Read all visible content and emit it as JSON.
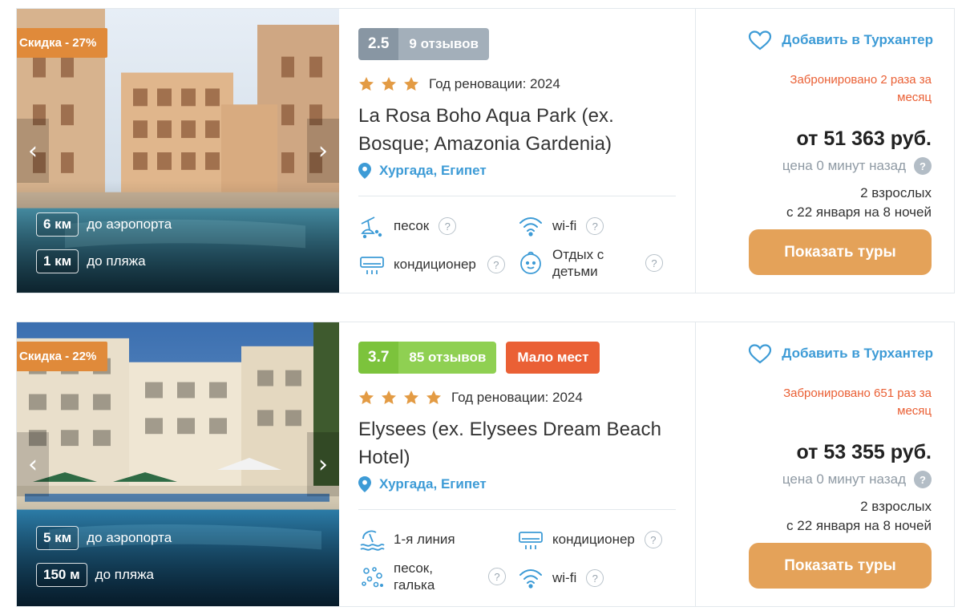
{
  "hotels": [
    {
      "discount": "Скидка - 27%",
      "airport_distance": "6 км",
      "airport_label": "до аэропорта",
      "beach_distance": "1 км",
      "beach_label": "до пляжа",
      "rating": "2.5",
      "reviews": "9 отзывов",
      "stars": 3,
      "renovation": "Год реновации: 2024",
      "name": "La Rosa Boho Aqua Park (ex. Bosque; Amazonia Gardenia)",
      "location": "Хургада, Египет",
      "amenities": [
        {
          "label": "песок",
          "icon": "sand-beach-icon"
        },
        {
          "label": "wi-fi",
          "icon": "wifi-icon"
        },
        {
          "label": "кондиционер",
          "icon": "air-conditioner-icon"
        },
        {
          "label": "Отдых с детьми",
          "icon": "kids-icon"
        }
      ],
      "favorite_label": "Добавить в Турхантер",
      "booked": "Забронировано 2 раза за месяц",
      "price": "от 51 363 руб.",
      "price_age": "цена 0 минут назад",
      "guests": "2 взрослых",
      "dates": "с 22 января на 8 ночей",
      "button": "Показать туры"
    },
    {
      "discount": "Скидка - 22%",
      "airport_distance": "5 км",
      "airport_label": "до аэропорта",
      "beach_distance": "150 м",
      "beach_label": "до пляжа",
      "rating": "3.7",
      "reviews": "85 отзывов",
      "few_places": "Мало мест",
      "stars": 4,
      "renovation": "Год реновации: 2024",
      "name": "Elysees (ex. Elysees Dream Beach Hotel)",
      "location": "Хургада, Египет",
      "amenities": [
        {
          "label": "1-я линия",
          "icon": "first-line-beach-icon"
        },
        {
          "label": "кондиционер",
          "icon": "air-conditioner-icon"
        },
        {
          "label": "песок, галька",
          "icon": "sand-pebble-icon"
        },
        {
          "label": "wi-fi",
          "icon": "wifi-icon"
        }
      ],
      "favorite_label": "Добавить в Турхантер",
      "booked": "Забронировано 651 раз за месяц",
      "price": "от 53 355 руб.",
      "price_age": "цена 0 минут назад",
      "guests": "2 взрослых",
      "dates": "с 22 января на 8 ночей",
      "button": "Показать туры"
    }
  ],
  "colors": {
    "accent_blue": "#3d9bd6",
    "orange_button": "#e4a259",
    "discount": "#e08a3a",
    "alert": "#ea6035",
    "star": "#e39b44"
  }
}
